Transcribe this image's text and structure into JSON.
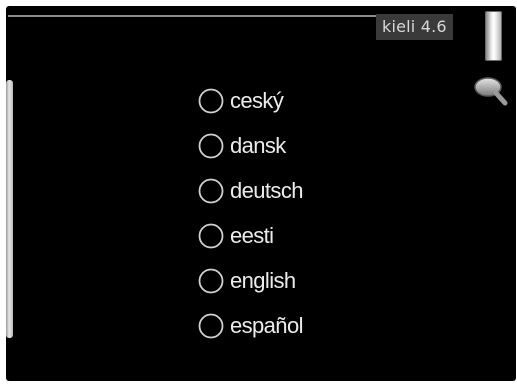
{
  "header": {
    "menu_title": "kieli 4.6"
  },
  "languages": [
    {
      "label": "ceský",
      "selected": false
    },
    {
      "label": "dansk",
      "selected": false
    },
    {
      "label": "deutsch",
      "selected": false
    },
    {
      "label": "eesti",
      "selected": false
    },
    {
      "label": "english",
      "selected": false
    },
    {
      "label": "español",
      "selected": false
    }
  ],
  "icons": {
    "search": "magnifier-icon",
    "level": "level-gauge-icon",
    "radio": "radio-button-icon"
  },
  "colors": {
    "screen_background": "#000000",
    "text": "#ececec",
    "badge_background": "#3a3a3a",
    "radio_outline": "#d0d0d0"
  }
}
